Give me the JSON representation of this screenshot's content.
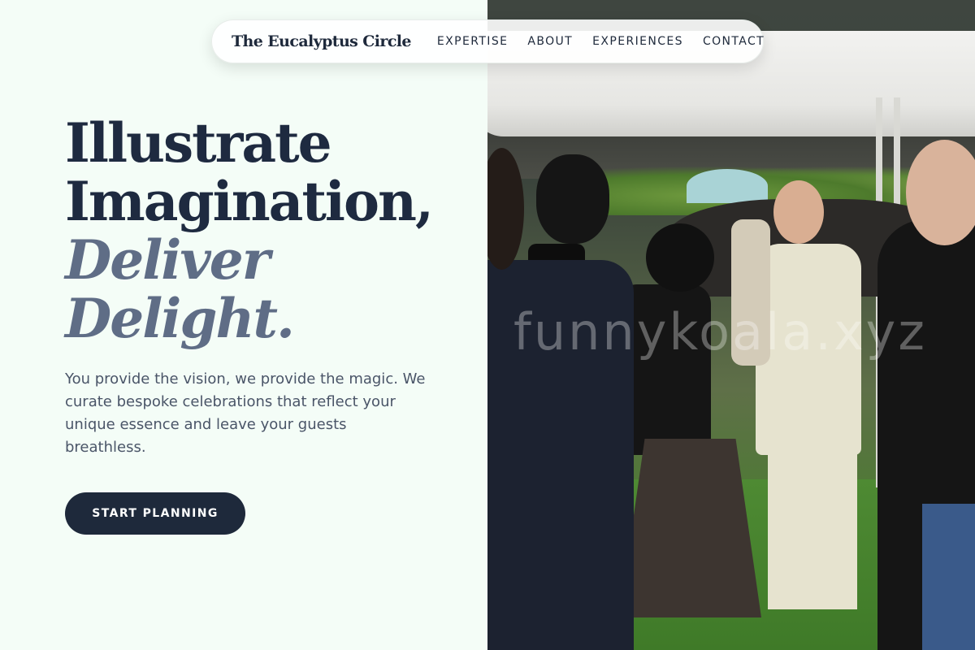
{
  "brand": "The Eucalyptus Circle",
  "nav": {
    "items": [
      {
        "label": "EXPERTISE"
      },
      {
        "label": "ABOUT"
      },
      {
        "label": "EXPERIENCES"
      },
      {
        "label": "CONTACT"
      }
    ]
  },
  "hero": {
    "headline_line1": "Illustrate",
    "headline_line2": "Imagination,",
    "headline_line3": "Deliver",
    "headline_line4": "Delight.",
    "description": "You provide the vision, we provide the magic. We curate bespoke celebrations that reflect your unique essence and leave your guests breathless.",
    "cta_label": "START PLANNING"
  },
  "photo": {
    "watermark": "funnykoala.xyz"
  },
  "colors": {
    "background": "#f4fdf7",
    "heading": "#1e2a40",
    "accent_italic": "#5f6d86",
    "button": "#1e293b"
  }
}
